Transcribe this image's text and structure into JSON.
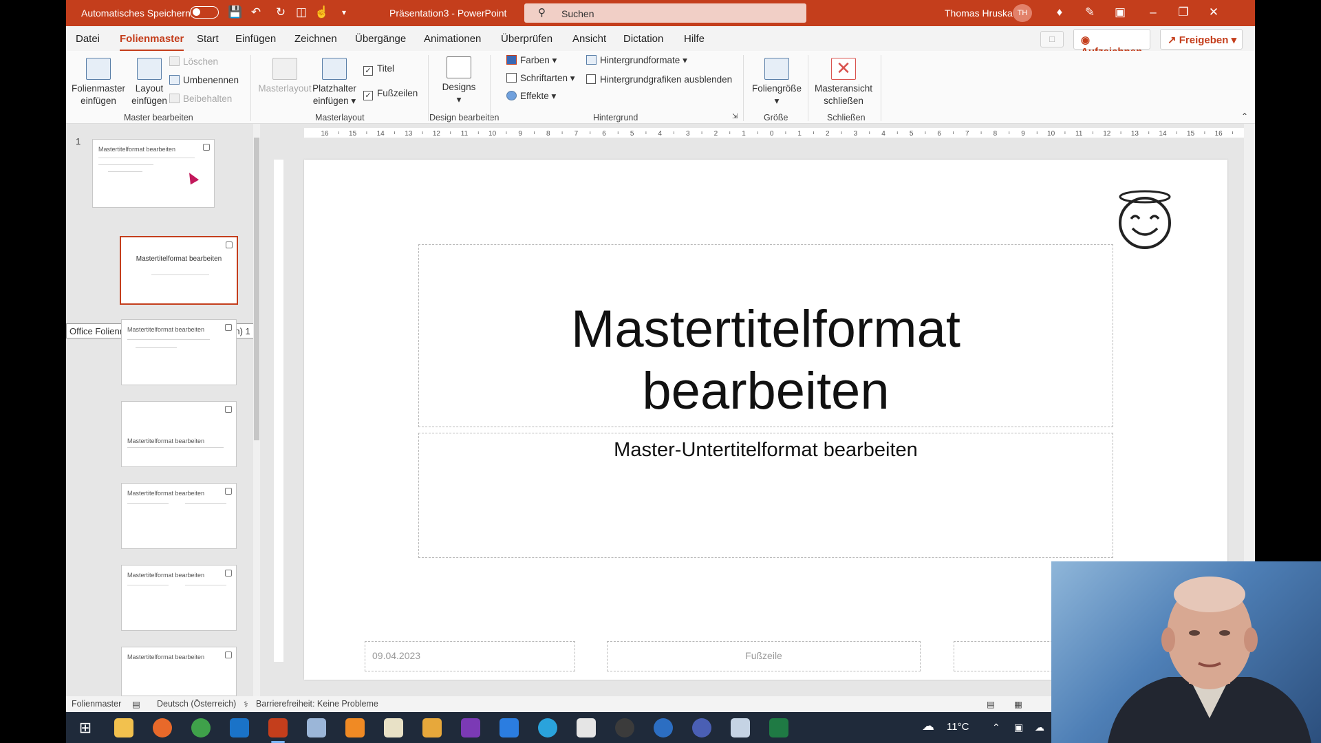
{
  "titlebar": {
    "autosave_label": "Automatisches Speichern",
    "doc_title": "Präsentation3  -  PowerPoint",
    "search_placeholder": "Suchen",
    "user_name": "Thomas Hruska",
    "user_initials": "TH",
    "accent_color": "#c43e1c"
  },
  "menu": {
    "tabs": [
      "Datei",
      "Folienmaster",
      "Start",
      "Einfügen",
      "Zeichnen",
      "Übergänge",
      "Animationen",
      "Überprüfen",
      "Ansicht",
      "Dictation",
      "Hilfe"
    ],
    "active_tab": "Folienmaster",
    "record_label": "Aufzeichnen",
    "share_label": "Freigeben"
  },
  "ribbon": {
    "master_insert": "Folienmaster einfügen",
    "layout_insert": "Layout einfügen",
    "delete": "Löschen",
    "rename": "Umbenennen",
    "preserve": "Beibehalten",
    "group_master": "Master bearbeiten",
    "master_layout": "Masterlayout",
    "placeholder_insert": "Platzhalter einfügen",
    "title_check": "Titel",
    "footer_check": "Fußzeilen",
    "group_masterlayout": "Masterlayout",
    "designs": "Designs",
    "group_design": "Design bearbeiten",
    "colors": "Farben",
    "fonts": "Schriftarten",
    "effects": "Effekte",
    "bg_formats": "Hintergrundformate",
    "hide_bg": "Hintergrundgrafiken ausblenden",
    "group_bg": "Hintergrund",
    "slide_size": "Foliengröße",
    "group_size": "Größe",
    "close_master": "Masteransicht schließen",
    "group_close": "Schließen"
  },
  "thumbs": {
    "slide_number": "1",
    "tooltip": "Office Folienmaster: verwendet von Folie(n) 1",
    "master_title": "Mastertitelformat bearbeiten",
    "layout_title": "Mastertitelformat bearbeiten"
  },
  "slide": {
    "title_line1": "Mastertitelformat",
    "title_line2": "bearbeiten",
    "subtitle": "Master-Untertitelformat bearbeiten",
    "date": "09.04.2023",
    "footer": "Fußzeile"
  },
  "ruler": {
    "h_ticks": [
      "16",
      "15",
      "14",
      "13",
      "12",
      "11",
      "10",
      "9",
      "8",
      "7",
      "6",
      "5",
      "4",
      "3",
      "2",
      "1",
      "0",
      "1",
      "2",
      "3",
      "4",
      "5",
      "6",
      "7",
      "8",
      "9",
      "10",
      "11",
      "12",
      "13",
      "14",
      "15",
      "16"
    ]
  },
  "status": {
    "mode": "Folienmaster",
    "language": "Deutsch (Österreich)",
    "accessibility": "Barrierefreiheit: Keine Probleme"
  },
  "taskbar": {
    "temperature": "11°C"
  }
}
